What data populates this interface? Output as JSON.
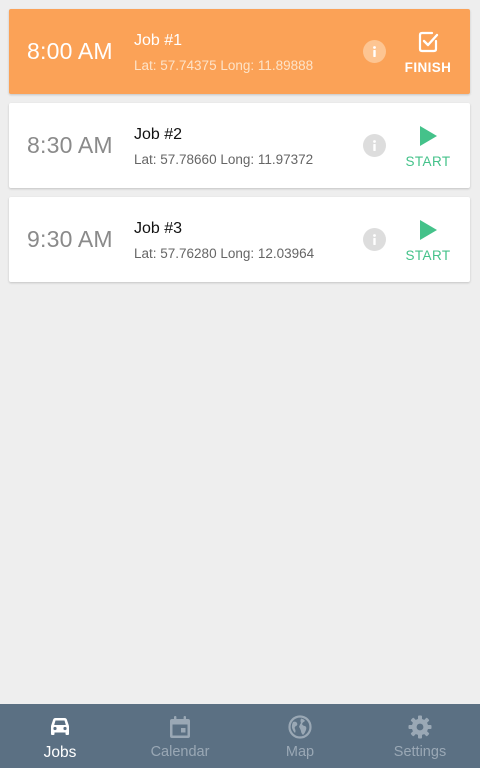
{
  "jobs": [
    {
      "time": "8:00 AM",
      "title": "Job #1",
      "coords": "Lat: 57.74375 Long: 11.89888",
      "action": "FINISH",
      "action_icon": "checkbox-icon",
      "active": true
    },
    {
      "time": "8:30 AM",
      "title": "Job #2",
      "coords": "Lat: 57.78660 Long: 11.97372",
      "action": "START",
      "action_icon": "play-icon",
      "active": false
    },
    {
      "time": "9:30 AM",
      "title": "Job #3",
      "coords": "Lat: 57.76280 Long: 12.03964",
      "action": "START",
      "action_icon": "play-icon",
      "active": false
    }
  ],
  "nav": {
    "items": [
      {
        "label": "Jobs",
        "icon": "car-icon",
        "selected": true
      },
      {
        "label": "Calendar",
        "icon": "calendar-icon",
        "selected": false
      },
      {
        "label": "Map",
        "icon": "globe-icon",
        "selected": false
      },
      {
        "label": "Settings",
        "icon": "gear-icon",
        "selected": false
      }
    ]
  },
  "colors": {
    "active_card": "#fba257",
    "start_green": "#44c28a",
    "nav_bg": "#5b7083",
    "background": "#eeeeee"
  }
}
